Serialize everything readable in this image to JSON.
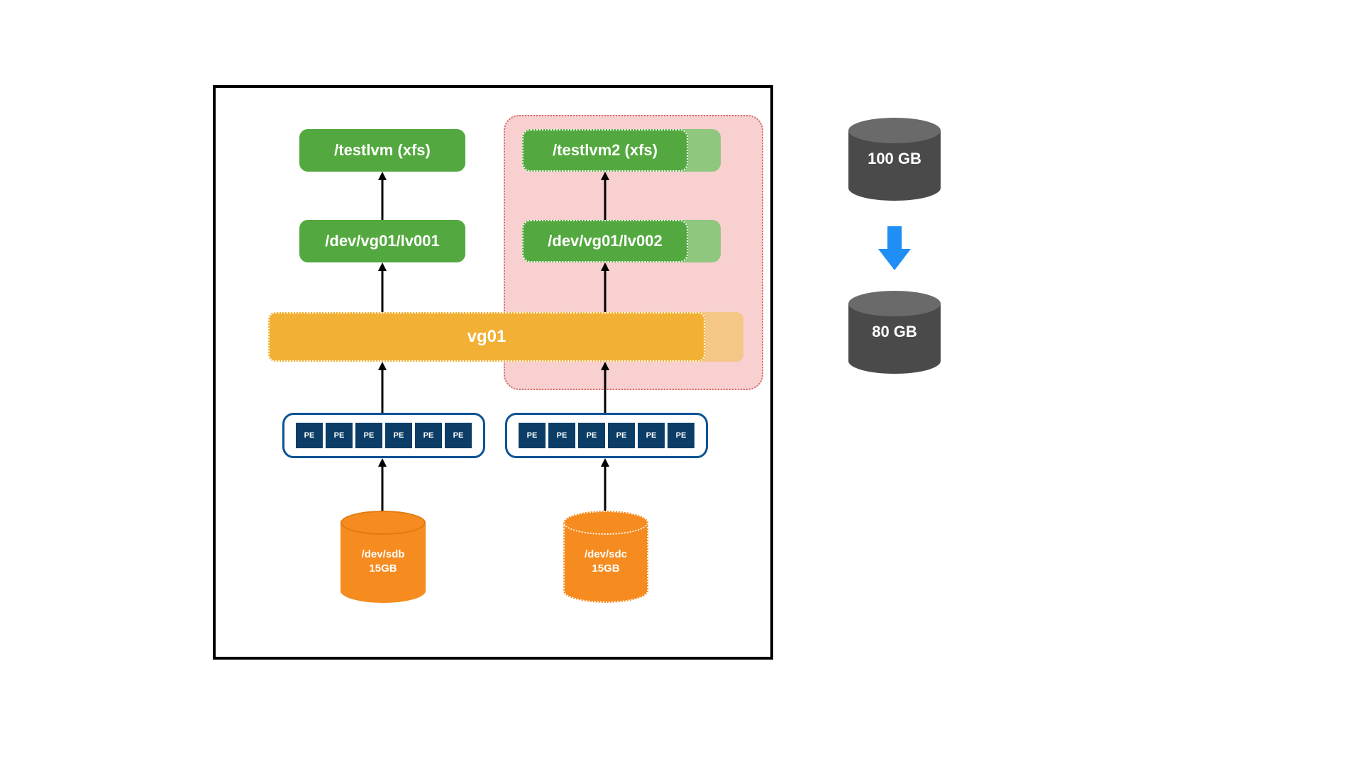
{
  "mounts": {
    "left": "/testlvm (xfs)",
    "right": "/testlvm2 (xfs)"
  },
  "lvs": {
    "left": "/dev/vg01/lv001",
    "right": "/dev/vg01/lv002"
  },
  "vg": {
    "name": "vg01"
  },
  "pe": {
    "label": "PE",
    "count_per_pv": 6
  },
  "pvs": {
    "left": {
      "path": "/dev/sdb",
      "size": "15GB"
    },
    "right": {
      "path": "/dev/sdc",
      "size": "15GB"
    }
  },
  "capacity": {
    "before": "100 GB",
    "after": "80 GB"
  },
  "colors": {
    "green": "#53a93f",
    "green_faded": "#8fc77e",
    "orange": "#f68b1f",
    "yellow": "#f2b134",
    "pink_bg": "#f8d0d0",
    "pink_border": "#d36b6b",
    "pv_border": "#0b5394",
    "pe_fill": "#0b3d66",
    "gray_top": "#6a6a6a",
    "gray_body": "#4a4a4a",
    "arrow_blue": "#1f8ff5"
  }
}
